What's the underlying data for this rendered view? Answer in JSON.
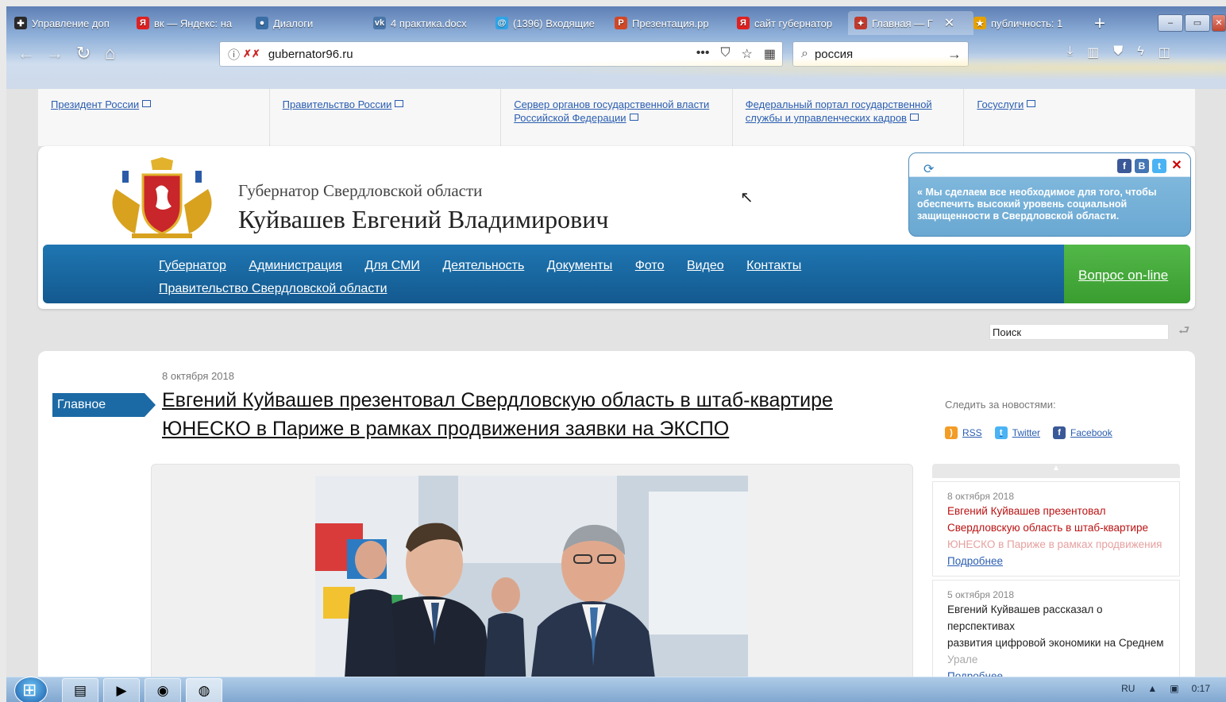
{
  "browser": {
    "tabs": [
      {
        "label": "Управление доп",
        "color": "#2a2a2a",
        "glyph": "✚"
      },
      {
        "label": "вк — Яндекс: на",
        "color": "#e02020",
        "glyph": "Я"
      },
      {
        "label": "Диалоги",
        "color": "#3a6ea5",
        "glyph": "●"
      },
      {
        "label": "4 практика.docx",
        "color": "#4a76a8",
        "glyph": "vk"
      },
      {
        "label": "(1396) Входящие",
        "color": "#2fa3e6",
        "glyph": "@"
      },
      {
        "label": "Презентация.pp",
        "color": "#d24726",
        "glyph": "P"
      },
      {
        "label": "сайт губернатор",
        "color": "#e02020",
        "glyph": "Я"
      },
      {
        "label": "Главная — Г",
        "color": "#c0392b",
        "glyph": "✦"
      },
      {
        "label": "публичность: 1",
        "color": "#e6a100",
        "glyph": "★"
      }
    ],
    "active_tab_close": "✕",
    "new_tab": "+",
    "url": "gubernator96.ru",
    "search_query": "россия"
  },
  "toplinks": [
    "Президент России",
    "Правительство России",
    "Сервер органов государственной власти Российской Федерации",
    "Федеральный портал государственной службы и управленческих кадров",
    "Госуслуги"
  ],
  "header": {
    "subtitle": "Губернатор Свердловской области",
    "name": "Куйвашев Евгений Владимирович",
    "quote": "Мы сделаем все необходимое для того, чтобы обеспечить высокий уровень социальной защищенности в Свердловской области.",
    "social": {
      "fb": "f",
      "b": "B",
      "tw": "t",
      "close": "✕"
    }
  },
  "menu": {
    "items": [
      "Губернатор",
      "Администрация",
      "Для СМИ",
      "Деятельность",
      "Документы",
      "Фото",
      "Видео",
      "Контакты",
      "Правительство Свердловской области"
    ],
    "question": "Вопрос on-line"
  },
  "search_placeholder": "Поиск",
  "main": {
    "date": "8 октября 2018",
    "tag": "Главное",
    "headline": "Евгений Куйвашев презентовал Свердловскую область в штаб-квартире ЮНЕСКО в Париже в рамках продвижения заявки на ЭКСПО"
  },
  "sidebar": {
    "follow": "Следить за новостями:",
    "feeds": [
      "RSS",
      "Twitter",
      "Facebook"
    ],
    "news": [
      {
        "date": "8 октября 2018",
        "title_a": "Евгений Куйвашев презентовал",
        "title_b": "Свердловскую область в штаб-квартире",
        "title_c": "ЮНЕСКО в Париже в рамках продвижения",
        "more": "Подробнее"
      },
      {
        "date": "5 октября 2018",
        "title_a": "Евгений Куйвашев рассказал о перспективах",
        "title_b": "развития цифровой экономики на Среднем",
        "title_c": "Урале",
        "more": "Подробнее"
      }
    ]
  },
  "taskbar": {
    "lang": "RU",
    "time": "0:17"
  }
}
